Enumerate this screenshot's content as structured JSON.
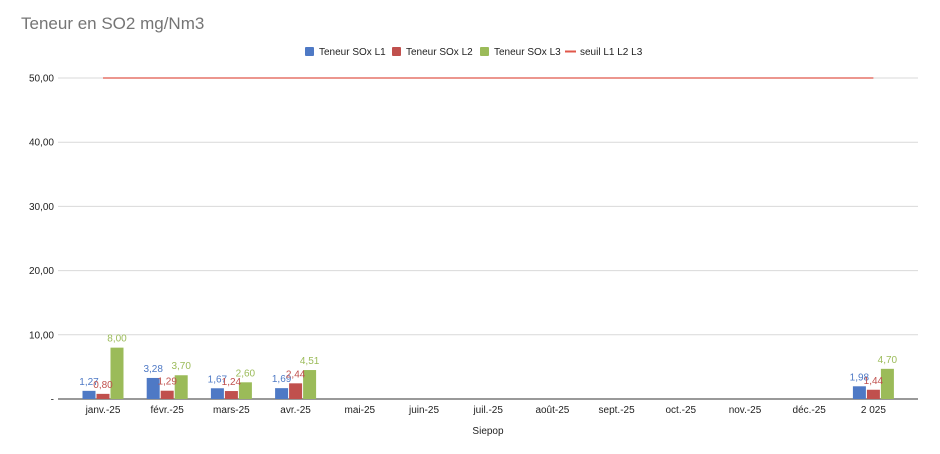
{
  "chart_data": {
    "type": "bar",
    "title": "Teneur en SO2 mg/Nm3",
    "xlabel": "Siepop",
    "ylabel": "",
    "categories": [
      "janv.-25",
      "févr.-25",
      "mars-25",
      "avr.-25",
      "mai-25",
      "juin-25",
      "juil.-25",
      "août-25",
      "sept.-25",
      "oct.-25",
      "nov.-25",
      "déc.-25",
      "2 025"
    ],
    "series": [
      {
        "name": "Teneur SOx L1",
        "color": "#4e79c5",
        "values": [
          1.27,
          3.28,
          1.67,
          1.69,
          null,
          null,
          null,
          null,
          null,
          null,
          null,
          null,
          1.98
        ],
        "labels": [
          "1,27",
          "3,28",
          "1,67",
          "1,69",
          "",
          "",
          "",
          "",
          "",
          "",
          "",
          "",
          "1,98"
        ]
      },
      {
        "name": "Teneur SOx L2",
        "color": "#c0504d",
        "values": [
          0.8,
          1.29,
          1.24,
          2.44,
          null,
          null,
          null,
          null,
          null,
          null,
          null,
          null,
          1.44
        ],
        "labels": [
          "0,80",
          "1,29",
          "1,24",
          "2,44",
          "",
          "",
          "",
          "",
          "",
          "",
          "",
          "",
          "1,44"
        ]
      },
      {
        "name": "Teneur SOx L3",
        "color": "#9bbb59",
        "values": [
          8.0,
          3.7,
          2.6,
          4.51,
          null,
          null,
          null,
          null,
          null,
          null,
          null,
          null,
          4.7
        ],
        "labels": [
          "8,00",
          "3,70",
          "2,60",
          "4,51",
          "",
          "",
          "",
          "",
          "",
          "",
          "",
          "",
          "4,70"
        ]
      }
    ],
    "threshold": {
      "name": "seuil L1 L2 L3",
      "value": 50,
      "color": "#e0574a"
    },
    "ylim": [
      0,
      50
    ],
    "yticks": [
      {
        "value": 0,
        "label": "-"
      },
      {
        "value": 10,
        "label": "10,00"
      },
      {
        "value": 20,
        "label": "20,00"
      },
      {
        "value": 30,
        "label": "30,00"
      },
      {
        "value": 40,
        "label": "40,00"
      },
      {
        "value": 50,
        "label": "50,00"
      }
    ],
    "grid": true,
    "legend_position": "top-center"
  }
}
